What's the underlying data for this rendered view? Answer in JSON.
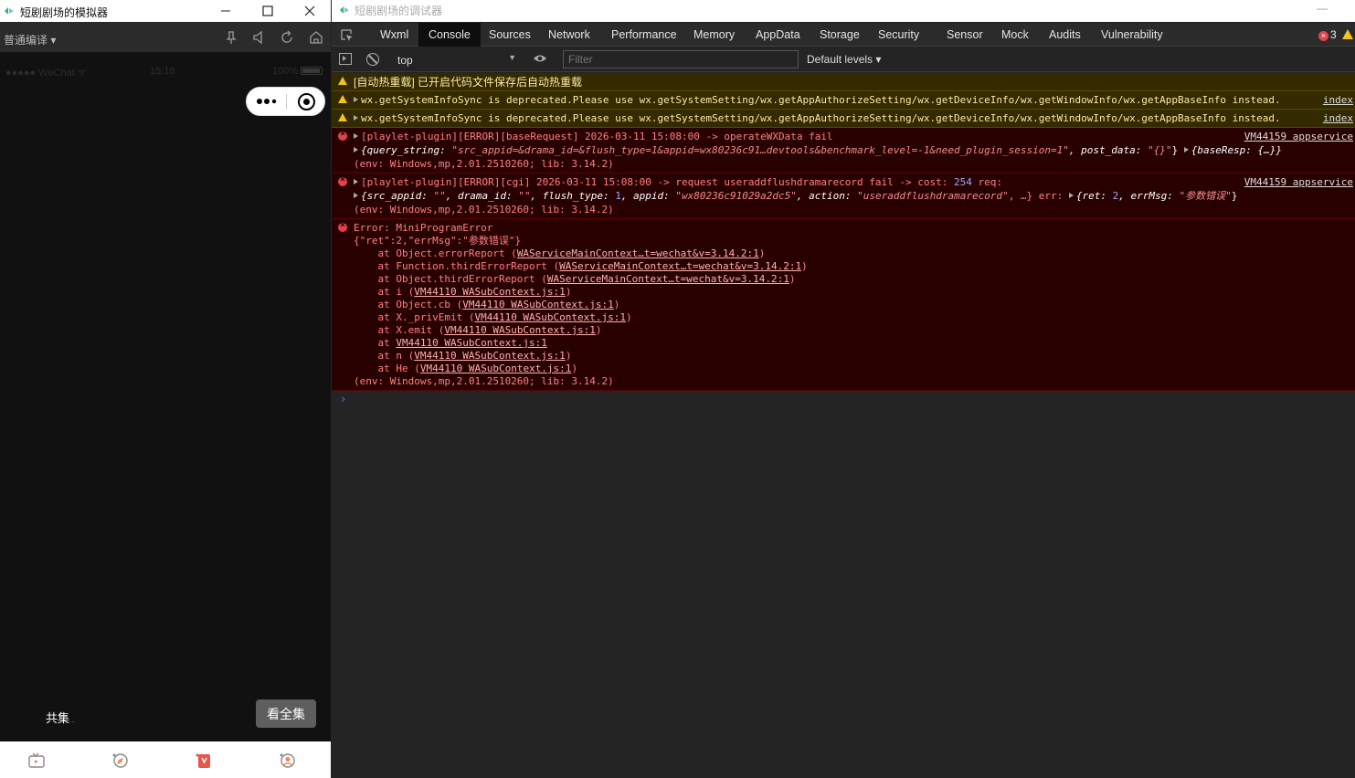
{
  "simulator": {
    "title": "短剧剧场的模拟器",
    "mode": "普通编译 ▾",
    "status_left": "●●●●● WeChat ᯤ",
    "status_time": "15:18",
    "status_battery": "100%",
    "episode_label": "共集",
    "episode_suffix": "...",
    "watch_all_label": "看全集"
  },
  "devtools": {
    "title": "短剧剧场的调试器",
    "tabs": [
      "Wxml",
      "Console",
      "Sources",
      "Network",
      "Performance",
      "Memory",
      "AppData",
      "Storage",
      "Security",
      "Sensor",
      "Mock",
      "Audits",
      "Vulnerability"
    ],
    "active_tab": "Console",
    "error_count": "3",
    "context": "top",
    "filter_placeholder": "Filter",
    "levels_label": "Default levels ▾"
  },
  "console": {
    "warn1": "[自动热重载] 已开启代码文件保存后自动热重载",
    "warn2": "wx.getSystemInfoSync is deprecated.Please use wx.getSystemSetting/wx.getAppAuthorizeSetting/wx.getDeviceInfo/wx.getWindowInfo/wx.getAppBaseInfo instead.",
    "warn_source": "index",
    "err1_l1": "[playlet-plugin][ERROR][baseRequest] 2026-03-11 15:08:00 -> operateWXData fail",
    "err1_source": "VM44159 appservice",
    "err1_l2_a": "{query_string: ",
    "err1_l2_b": "\"src_appid=&drama_id=&flush_type=1&appid=wx80236c91…devtools&benchmark_level=-1&need_plugin_session=1\"",
    "err1_l2_c": ", post_data: ",
    "err1_l2_d": "\"{}\"",
    "err1_l2_e": "} ",
    "err1_l2_f": "{baseResp: {…}}",
    "env": "(env: Windows,mp,2.01.2510260; lib: 3.14.2)",
    "err2_l1_a": "[playlet-plugin][ERROR][cgi] 2026-03-11 15:08:00 -> request useraddflushdramarecord fail -> cost: ",
    "err2_l1_b": "254",
    "err2_l1_c": " req:",
    "err2_source": "VM44159 appservice",
    "err2_l2_a": "{src_appid: ",
    "err2_l2_b": "\"\"",
    "err2_l2_c": ", drama_id: ",
    "err2_l2_d": "\"\"",
    "err2_l2_e": ", flush_type: ",
    "err2_l2_f": "1",
    "err2_l2_g": ", appid: ",
    "err2_l2_h": "\"wx80236c91029a2dc5\"",
    "err2_l2_i": ", action: ",
    "err2_l2_j": "\"useraddflushdramarecord\"",
    "err2_l2_k": ", …} err: ",
    "err2_l2_l": "{ret: ",
    "err2_l2_m": "2",
    "err2_l2_n": ", errMsg: ",
    "err2_l2_o": "\"参数错误\"",
    "err2_l2_p": "}",
    "err3_l1": "Error: MiniProgramError",
    "err3_l2": "{\"ret\":2,\"errMsg\":\"参数错误\"}",
    "stack": [
      {
        "fn": "    at Object.errorReport (",
        "link": "WAServiceMainContext…t=wechat&v=3.14.2:1",
        "end": ")"
      },
      {
        "fn": "    at Function.thirdErrorReport (",
        "link": "WAServiceMainContext…t=wechat&v=3.14.2:1",
        "end": ")"
      },
      {
        "fn": "    at Object.thirdErrorReport (",
        "link": "WAServiceMainContext…t=wechat&v=3.14.2:1",
        "end": ")"
      },
      {
        "fn": "    at i (",
        "link": "VM44110 WASubContext.js:1",
        "end": ")"
      },
      {
        "fn": "    at Object.cb (",
        "link": "VM44110 WASubContext.js:1",
        "end": ")"
      },
      {
        "fn": "    at X._privEmit (",
        "link": "VM44110 WASubContext.js:1",
        "end": ")"
      },
      {
        "fn": "    at X.emit (",
        "link": "VM44110 WASubContext.js:1",
        "end": ")"
      },
      {
        "fn": "    at ",
        "link": "VM44110 WASubContext.js:1",
        "end": ""
      },
      {
        "fn": "    at n (",
        "link": "VM44110 WASubContext.js:1",
        "end": ")"
      },
      {
        "fn": "    at He (",
        "link": "VM44110 WASubContext.js:1",
        "end": ")"
      }
    ],
    "prompt": "›"
  },
  "icons": {
    "window_min": "minimize-icon",
    "window_max": "maximize-icon",
    "window_close": "close-icon",
    "warning": "warning-icon",
    "error": "error-icon"
  },
  "colors": {
    "warn_bg": "#332a00",
    "error_bg": "#290000",
    "error_text": "#ff8080",
    "accent_red": "#e2434b"
  }
}
